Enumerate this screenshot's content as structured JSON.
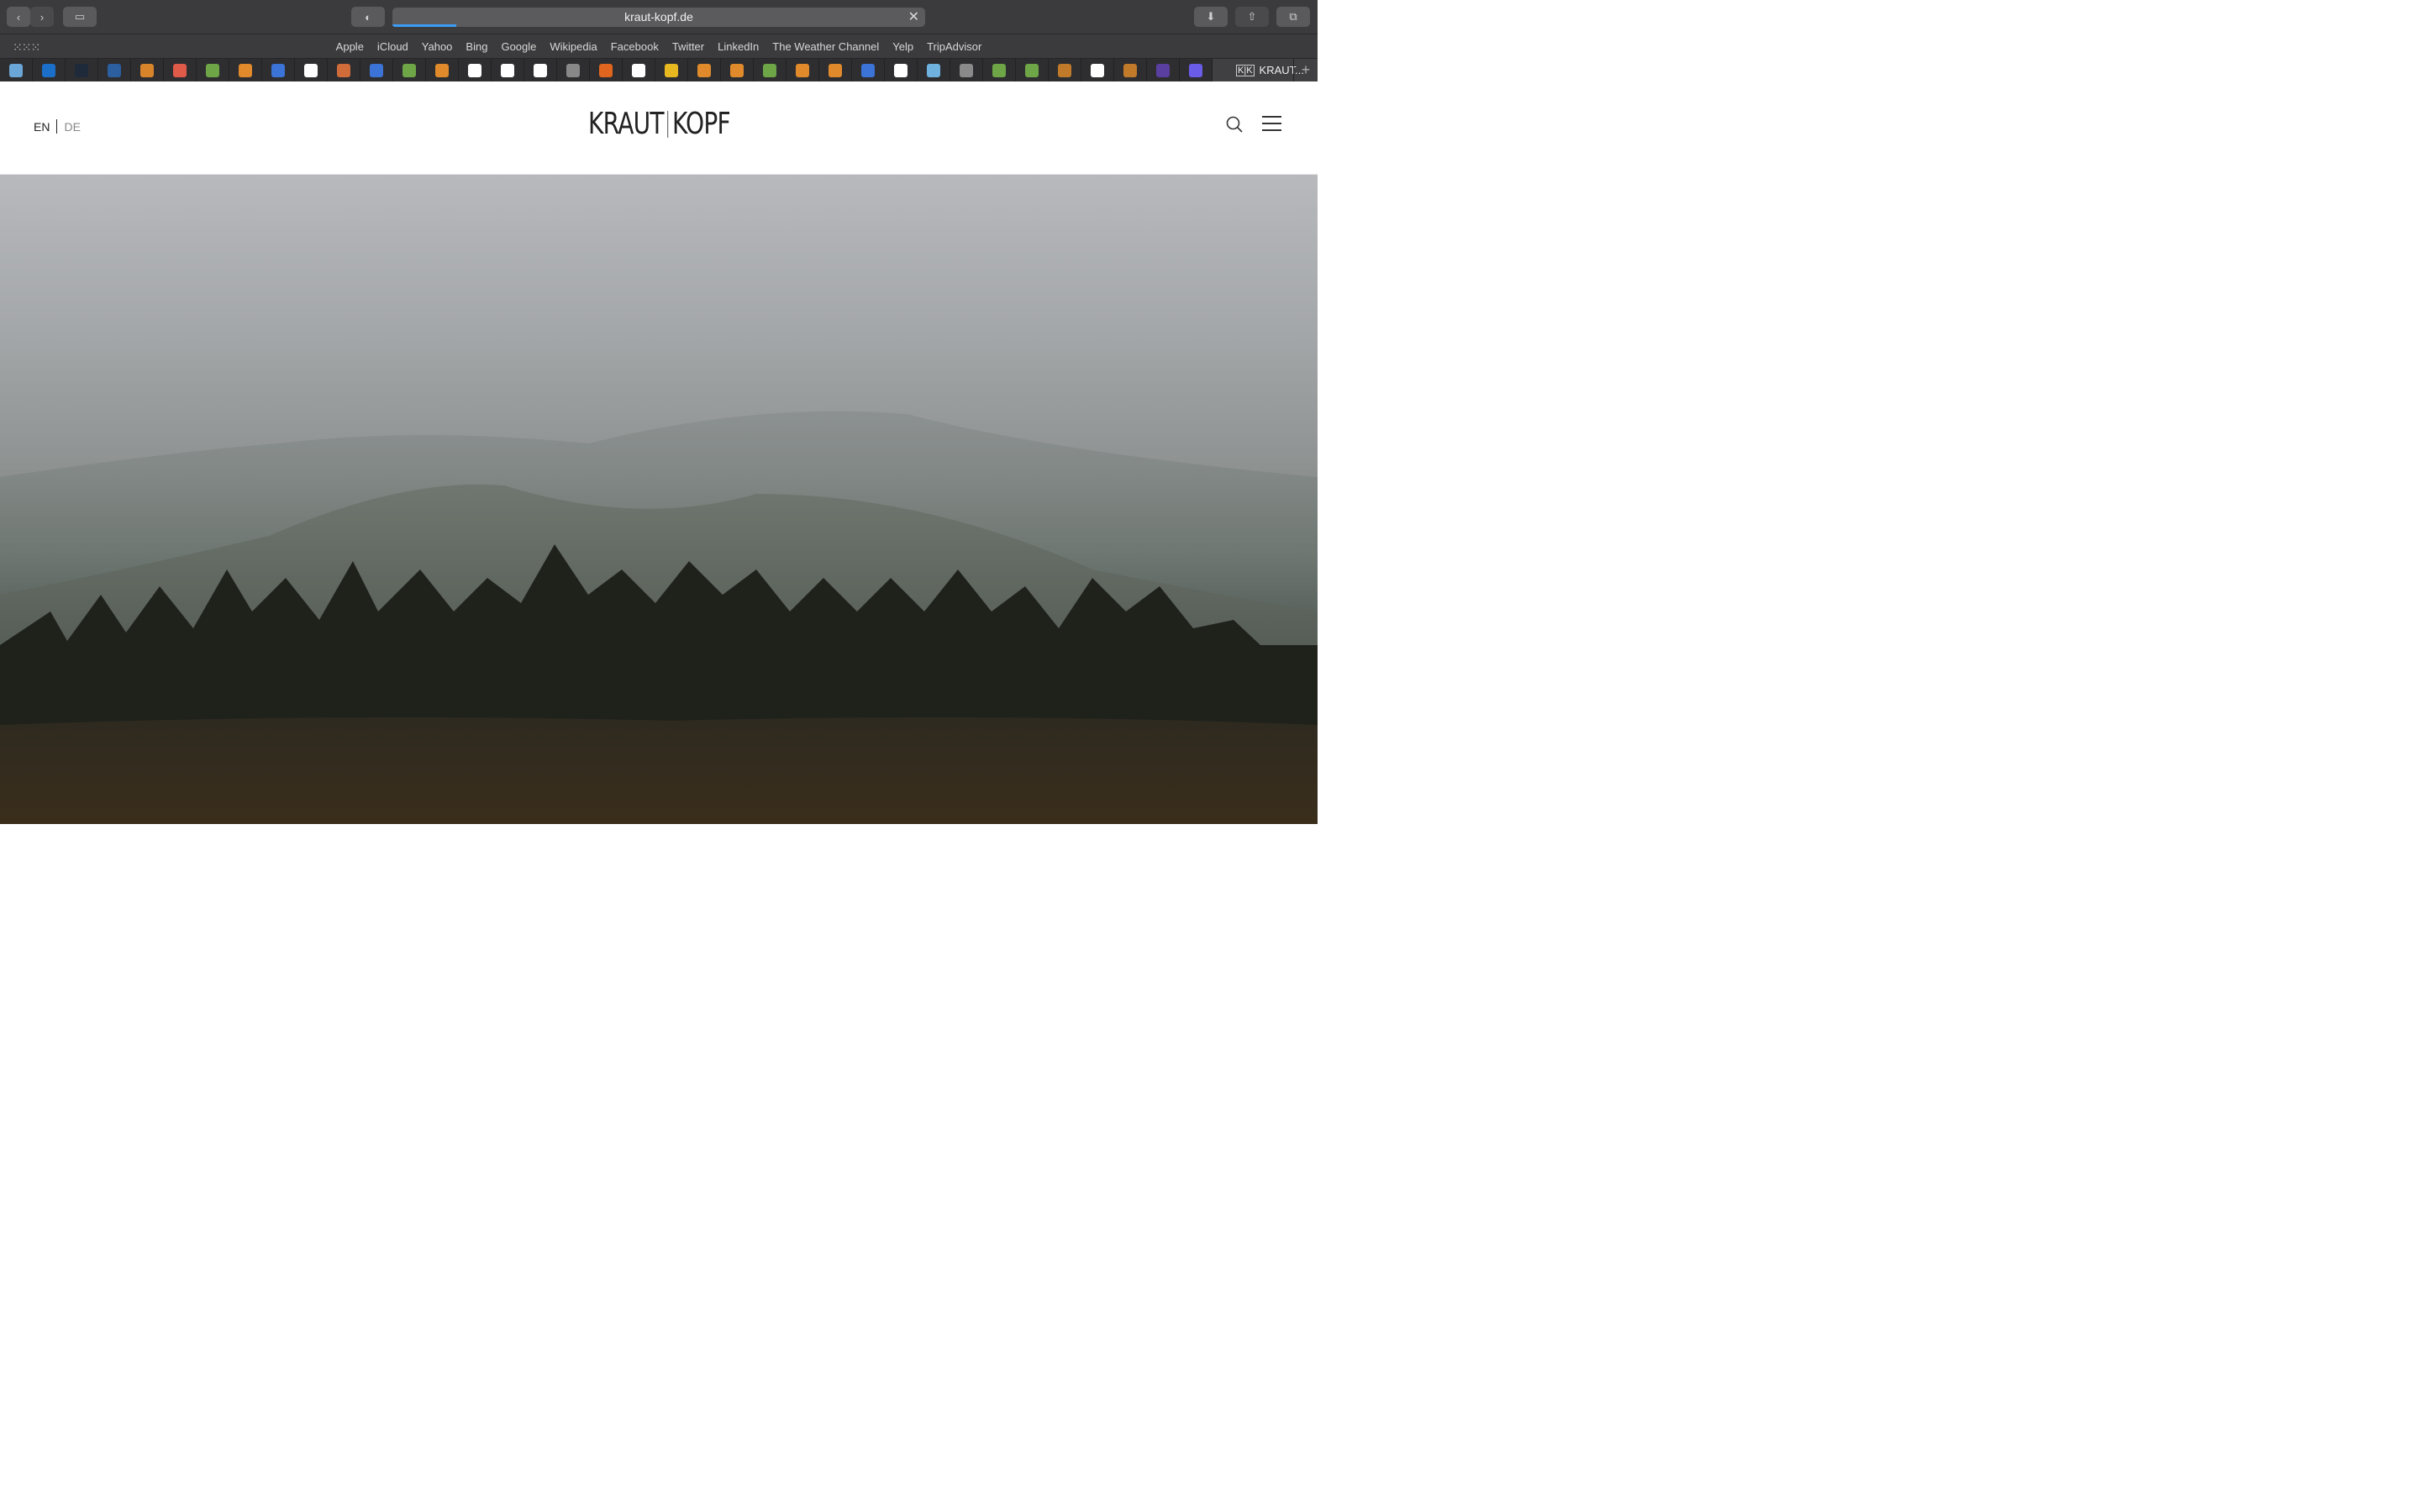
{
  "browser": {
    "url": "kraut-kopf.de",
    "favorites": [
      "Apple",
      "iCloud",
      "Yahoo",
      "Bing",
      "Google",
      "Wikipedia",
      "Facebook",
      "Twitter",
      "LinkedIn",
      "The Weather Channel",
      "Yelp",
      "TripAdvisor"
    ],
    "active_tab_title": "KRAUT...",
    "tab_icons": [
      {
        "name": "weather-icon",
        "color": "#6aa7d8"
      },
      {
        "name": "outlook-icon",
        "color": "#1b6fc8"
      },
      {
        "name": "shield-icon",
        "color": "#1e2a3a"
      },
      {
        "name": "grid-app-icon",
        "color": "#2b5fa0"
      },
      {
        "name": "star-icon",
        "color": "#d8842b"
      },
      {
        "name": "asterisk-icon",
        "color": "#e05a4a"
      },
      {
        "name": "w3-icon",
        "color": "#6ea547"
      },
      {
        "name": "stack-icon",
        "color": "#e08a2b"
      },
      {
        "name": "flag-icon",
        "color": "#3b73d6"
      },
      {
        "name": "google-icon",
        "color": "#ffffff"
      },
      {
        "name": "code-icon",
        "color": "#cf6c3a"
      },
      {
        "name": "flag-icon",
        "color": "#3b73d6"
      },
      {
        "name": "w3-icon",
        "color": "#6ea547"
      },
      {
        "name": "stack-icon",
        "color": "#e08a2b"
      },
      {
        "name": "github-icon",
        "color": "#ffffff"
      },
      {
        "name": "google-icon",
        "color": "#ffffff"
      },
      {
        "name": "google-icon",
        "color": "#ffffff"
      },
      {
        "name": "compass-icon",
        "color": "#888888"
      },
      {
        "name": "ring-icon",
        "color": "#e0651e"
      },
      {
        "name": "checker-icon",
        "color": "#ffffff"
      },
      {
        "name": "emoji-icon",
        "color": "#e8b820"
      },
      {
        "name": "stack-icon",
        "color": "#e08a2b"
      },
      {
        "name": "stack-icon",
        "color": "#e08a2b"
      },
      {
        "name": "w3-icon",
        "color": "#6ea547"
      },
      {
        "name": "stack-icon",
        "color": "#e08a2b"
      },
      {
        "name": "stack-icon",
        "color": "#e08a2b"
      },
      {
        "name": "flag-icon",
        "color": "#3b73d6"
      },
      {
        "name": "google-icon",
        "color": "#ffffff"
      },
      {
        "name": "bug-icon",
        "color": "#6fb2e0"
      },
      {
        "name": "b-icon",
        "color": "#8a8a8a"
      },
      {
        "name": "w3-icon",
        "color": "#6ea547"
      },
      {
        "name": "w3-icon",
        "color": "#6ea547"
      },
      {
        "name": "leaf-icon",
        "color": "#c07a2a"
      },
      {
        "name": "google-icon",
        "color": "#ffffff"
      },
      {
        "name": "leaf-icon",
        "color": "#c07a2a"
      },
      {
        "name": "colorlib-icon",
        "color": "#5a3fa0"
      },
      {
        "name": "mail-icon",
        "color": "#6b5ce8"
      }
    ]
  },
  "site": {
    "lang_en": "EN",
    "lang_de": "DE",
    "logo_left": "KRAUT",
    "logo_right": "KOPF"
  }
}
